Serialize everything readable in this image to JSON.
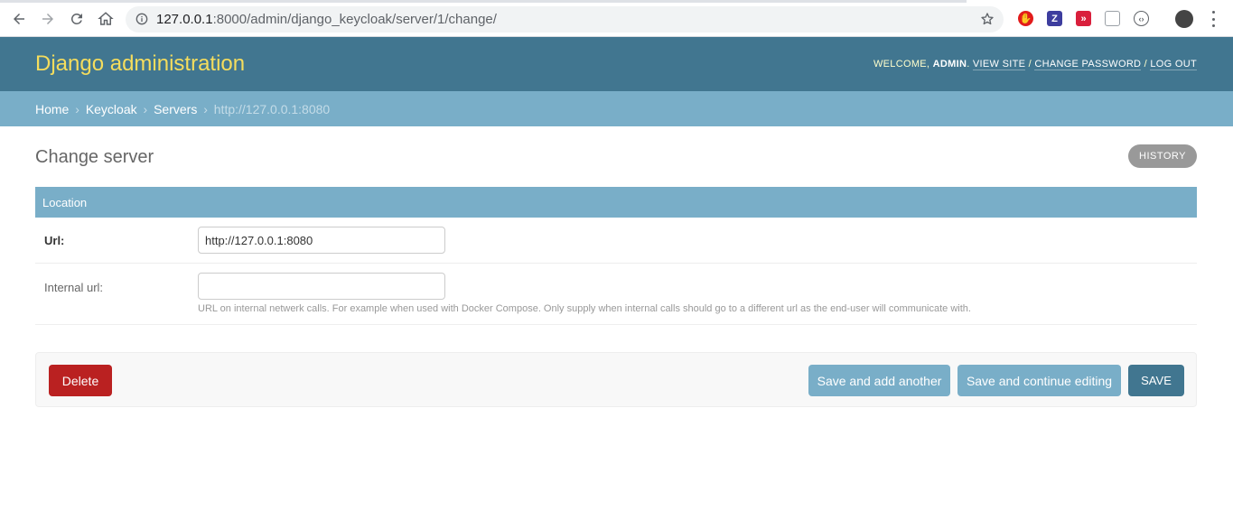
{
  "browser": {
    "url_host": "127.0.0.1",
    "url_path": ":8000/admin/django_keycloak/server/1/change/"
  },
  "header": {
    "brand": "Django administration",
    "welcome": "WELCOME, ",
    "user": "ADMIN",
    "view_site": "VIEW SITE",
    "change_password": "CHANGE PASSWORD",
    "log_out": "LOG OUT",
    "sep": " / "
  },
  "breadcrumbs": {
    "home": "Home",
    "app": "Keycloak",
    "model": "Servers",
    "current": "http://127.0.0.1:8080",
    "sep": "›"
  },
  "page": {
    "title": "Change server",
    "history": "HISTORY"
  },
  "fieldset": {
    "title": "Location",
    "url_label": "Url:",
    "url_value": "http://127.0.0.1:8080",
    "internal_label": "Internal url:",
    "internal_value": "",
    "internal_help": "URL on internal netwerk calls. For example when used with Docker Compose. Only supply when internal calls should go to a different url as the end-user will communicate with."
  },
  "actions": {
    "delete": "Delete",
    "save_add_another": "Save and add another",
    "save_continue": "Save and continue editing",
    "save": "SAVE"
  },
  "colors": {
    "header_bg": "#417690",
    "brand": "#f5dd5d",
    "breadcrumb_bg": "#79aec8",
    "delete": "#ba2121"
  }
}
